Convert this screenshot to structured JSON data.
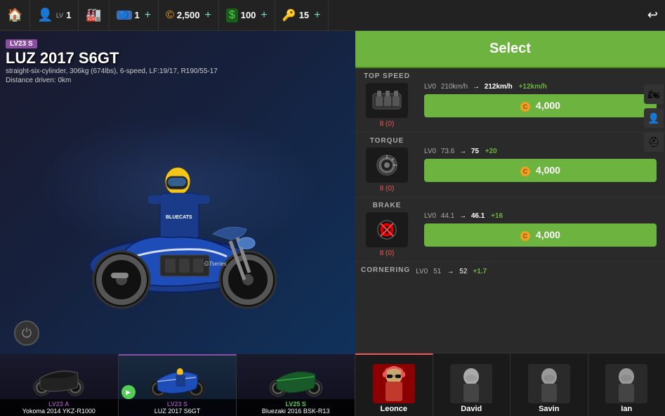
{
  "topbar": {
    "home_icon": "🏠",
    "player_level": "1",
    "garage_icon": "🏭",
    "token_icon": "🔵",
    "token_count": "1",
    "token_plus": "+",
    "coin_icon": "©",
    "coin_count": "2,500",
    "coin_plus": "+",
    "cash_icon": "$",
    "cash_count": "100",
    "cash_plus": "+",
    "key_icon": "🔑",
    "key_count": "15",
    "key_plus": "+",
    "back_icon": "↩"
  },
  "bike": {
    "level_badge": "LV23  S",
    "name": "LUZ 2017 S6GT",
    "subtitle": "straight-six-cylinder, 306kg (674lbs), 6-speed, LF:19/17, R190/55-17",
    "distance": "Distance driven: 0km",
    "select_label": "Select"
  },
  "carousel": [
    {
      "level": "LV23 A",
      "name": "Yokoma 2014 YKZ-R1000",
      "active": false
    },
    {
      "level": "LV23 S",
      "name": "LUZ 2017 S6GT",
      "active": true,
      "has_play": true
    },
    {
      "level": "LV25 S",
      "name": "Bluezaki 2016 BSK-R13",
      "active": false
    }
  ],
  "stats": [
    {
      "label": "TOP SPEED",
      "lv": "LV0",
      "from": "210km/h",
      "to": "212km/h",
      "bonus": "+12km/h",
      "cost": "4,000",
      "count": "8 (0)",
      "icon": "engine"
    },
    {
      "label": "TORQUE",
      "lv": "LV0",
      "from": "73.6",
      "to": "75",
      "bonus": "+20",
      "cost": "4,000",
      "count": "8 (0)",
      "icon": "engine2"
    },
    {
      "label": "BRAKE",
      "lv": "LV0",
      "from": "44.1",
      "to": "46.1",
      "bonus": "+16",
      "cost": "4,000",
      "count": "8 (0)",
      "icon": "brake"
    },
    {
      "label": "CORNERING",
      "lv": "LV0",
      "from": "51",
      "to": "52",
      "bonus": "+1.7",
      "cost": "",
      "count": "",
      "icon": "cornering"
    }
  ],
  "riders": [
    {
      "name": "Leonce",
      "active": true,
      "color": "#c0392b"
    },
    {
      "name": "David",
      "active": false,
      "color": "#444"
    },
    {
      "name": "Savin",
      "active": false,
      "color": "#444"
    },
    {
      "name": "Ian",
      "active": false,
      "color": "#444"
    }
  ],
  "side_icons": [
    "🏍",
    "👤",
    "⛑"
  ]
}
